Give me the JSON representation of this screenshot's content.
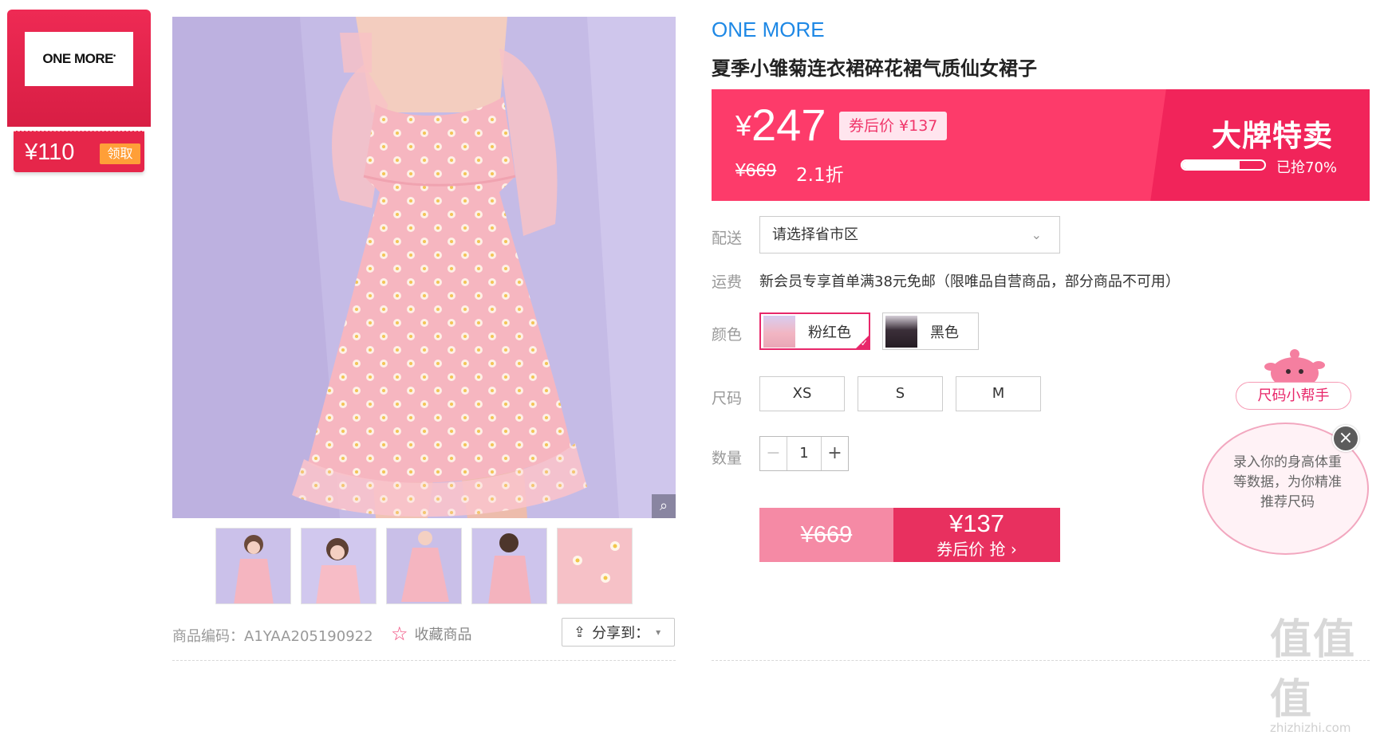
{
  "coupon": {
    "logo_text": "ONE MORE",
    "amount": "¥110",
    "claim_label": "领取"
  },
  "gallery": {
    "thumbnail_count": 5
  },
  "meta": {
    "product_code": "商品编码：A1YAA205190922",
    "favorite_label": "收藏商品",
    "share_label": "分享到："
  },
  "product": {
    "brand": "ONE MORE",
    "title": "夏季小雏菊连衣裙碎花裙气质仙女裙子"
  },
  "price_banner": {
    "currency": "¥",
    "price": "247",
    "after_coupon_tag": "券后价 ¥137",
    "original_price": "¥669",
    "discount": "2.1折",
    "sale_title": "大牌特卖",
    "sold_fraction": 0.7,
    "sold_text": "已抢70%"
  },
  "delivery": {
    "label": "配送",
    "placeholder": "请选择省市区"
  },
  "shipping": {
    "label": "运费",
    "text": "新会员专享首单满38元免邮（限唯品自营商品，部分商品不可用）"
  },
  "color": {
    "label": "颜色",
    "options": [
      {
        "label": "粉红色",
        "selected": true
      },
      {
        "label": "黑色",
        "selected": false
      }
    ]
  },
  "size": {
    "label": "尺码",
    "options": [
      "XS",
      "S",
      "M"
    ]
  },
  "quantity": {
    "label": "数量",
    "value": "1",
    "minus": "−",
    "plus": "+"
  },
  "buy": {
    "original_price": "¥669",
    "coupon_price": "¥137",
    "cta": "券后价 抢 ›"
  },
  "size_helper": {
    "tag": "尺码小帮手",
    "bubble_text": "录入你的身高体重等数据，为你精准推荐尺码",
    "close": "×"
  },
  "watermark": {
    "big": "值值值",
    "small": "zhizhizhi.com"
  },
  "colors": {
    "brand_blue": "#1e88e5",
    "banner_pink": "#fd3b6a",
    "accent": "#e8276a",
    "coupon_red": "#e6264a"
  }
}
